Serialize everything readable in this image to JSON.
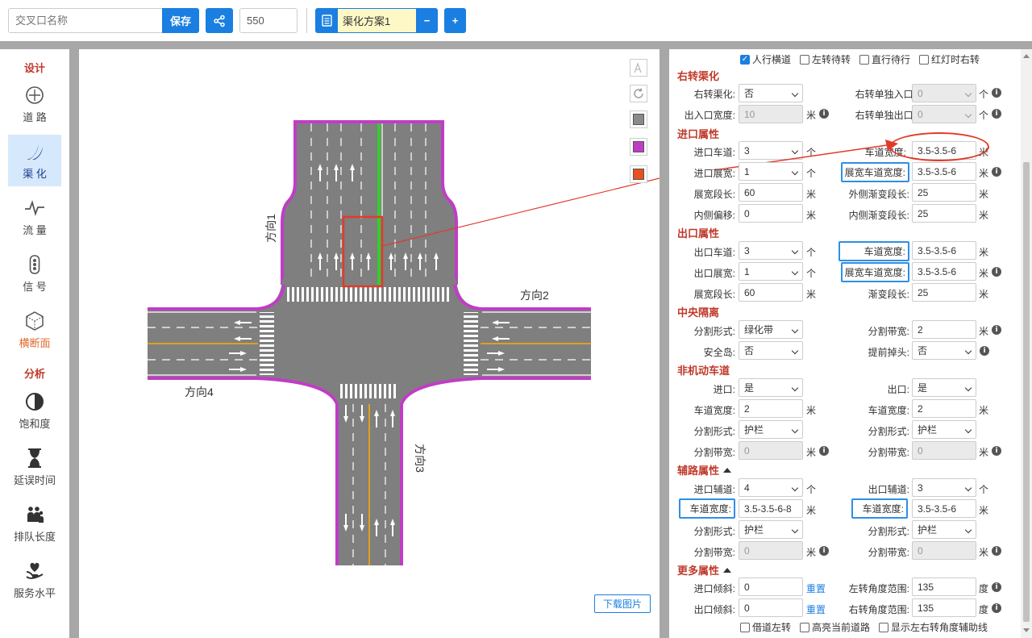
{
  "topbar": {
    "name_placeholder": "交叉口名称",
    "save_label": "保存",
    "number_value": "550",
    "scheme_name": "渠化方案1",
    "minus_label": "−",
    "plus_label": "+"
  },
  "sidebar": {
    "design_label": "设计",
    "analysis_label": "分析",
    "items": [
      {
        "label": "道 路",
        "icon": "road-icon"
      },
      {
        "label": "渠 化",
        "icon": "channelize-icon"
      },
      {
        "label": "流 量",
        "icon": "flow-icon"
      },
      {
        "label": "信 号",
        "icon": "signal-icon"
      },
      {
        "label": "横断面",
        "icon": "cross-section-icon"
      },
      {
        "label": "饱和度",
        "icon": "saturation-icon"
      },
      {
        "label": "延误时间",
        "icon": "hourglass-icon"
      },
      {
        "label": "排队长度",
        "icon": "queue-icon"
      },
      {
        "label": "服务水平",
        "icon": "service-icon"
      }
    ]
  },
  "canvas": {
    "dir1": "方向1",
    "dir2": "方向2",
    "dir3": "方向3",
    "dir4": "方向4",
    "download_label": "下载图片",
    "colors": {
      "road": "#7f7f7f",
      "curb": "#c13cc6",
      "green": "#36cc2e",
      "yellow": "#e0a020",
      "highlight": "#e23a2a"
    }
  },
  "panel": {
    "top_checks": [
      "人行横道",
      "左转待转",
      "直行待行",
      "红灯时右转"
    ],
    "top_checks_on": [
      true,
      false,
      false,
      false
    ],
    "right_turn": {
      "title": "右转渠化",
      "l1": "右转渠化:",
      "v1": "否",
      "l2": "右转单独入口:",
      "v2": "0",
      "u2": "个",
      "l3": "出入口宽度:",
      "v3": "10",
      "u3": "米",
      "l4": "右转单独出口:",
      "v4": "0",
      "u4": "个"
    },
    "entry": {
      "title": "进口属性",
      "l1": "进口车道:",
      "v1": "3",
      "u1": "个",
      "l2": "车道宽度:",
      "v2": "3.5-3.5-6",
      "u2": "米",
      "l3": "进口展宽:",
      "v3": "1",
      "u3": "个",
      "l4": "展宽车道宽度:",
      "v4": "3.5-3.5-6",
      "u4": "米",
      "l5": "展宽段长:",
      "v5": "60",
      "u5": "米",
      "l6": "外侧渐变段长:",
      "v6": "25",
      "u6": "米",
      "l7": "内侧偏移:",
      "v7": "0",
      "u7": "米",
      "l8": "内侧渐变段长:",
      "v8": "25",
      "u8": "米"
    },
    "exit": {
      "title": "出口属性",
      "l1": "出口车道:",
      "v1": "3",
      "u1": "个",
      "l2": "车道宽度:",
      "v2": "3.5-3.5-6",
      "u2": "米",
      "l3": "出口展宽:",
      "v3": "1",
      "u3": "个",
      "l4": "展宽车道宽度:",
      "v4": "3.5-3.5-6",
      "u4": "米",
      "l5": "展宽段长:",
      "v5": "60",
      "u5": "米",
      "l6": "渐变段长:",
      "v6": "25",
      "u6": "米"
    },
    "median": {
      "title": "中央隔离",
      "l1": "分割形式:",
      "v1": "绿化带",
      "l2": "分割带宽:",
      "v2": "2",
      "u2": "米",
      "l3": "安全岛:",
      "v3": "否",
      "l4": "提前掉头:",
      "v4": "否"
    },
    "nonmotor": {
      "title": "非机动车道",
      "l1": "进口:",
      "v1": "是",
      "l2": "出口:",
      "v2": "是",
      "l3": "车道宽度:",
      "v3": "2",
      "u3": "米",
      "l4": "车道宽度:",
      "v4": "2",
      "u4": "米",
      "l5": "分割形式:",
      "v5": "护栏",
      "l6": "分割形式:",
      "v6": "护栏",
      "l7": "分割带宽:",
      "v7": "0",
      "u7": "米",
      "l8": "分割带宽:",
      "v8": "0",
      "u8": "米"
    },
    "aux": {
      "title": "辅路属性",
      "l1": "进口辅道:",
      "v1": "4",
      "u1": "个",
      "l2": "出口辅道:",
      "v2": "3",
      "u2": "个",
      "l3": "车道宽度:",
      "v3": "3.5-3.5-6-8",
      "u3": "米",
      "l4": "车道宽度:",
      "v4": "3.5-3.5-6",
      "u4": "米",
      "l5": "分割形式:",
      "v5": "护栏",
      "l6": "分割形式:",
      "v6": "护栏",
      "l7": "分割带宽:",
      "v7": "0",
      "u7": "米",
      "l8": "分割带宽:",
      "v8": "0",
      "u8": "米"
    },
    "more": {
      "title": "更多属性",
      "l1": "进口倾斜:",
      "v1": "0",
      "reset": "重置",
      "l2": "左转角度范围:",
      "v2": "135",
      "u2": "度",
      "l3": "出口倾斜:",
      "v3": "0",
      "l4": "右转角度范围:",
      "v4": "135",
      "u4": "度"
    },
    "bottom_checks": [
      "借道左转",
      "高亮当前道路",
      "显示左右转角度辅助线"
    ]
  }
}
